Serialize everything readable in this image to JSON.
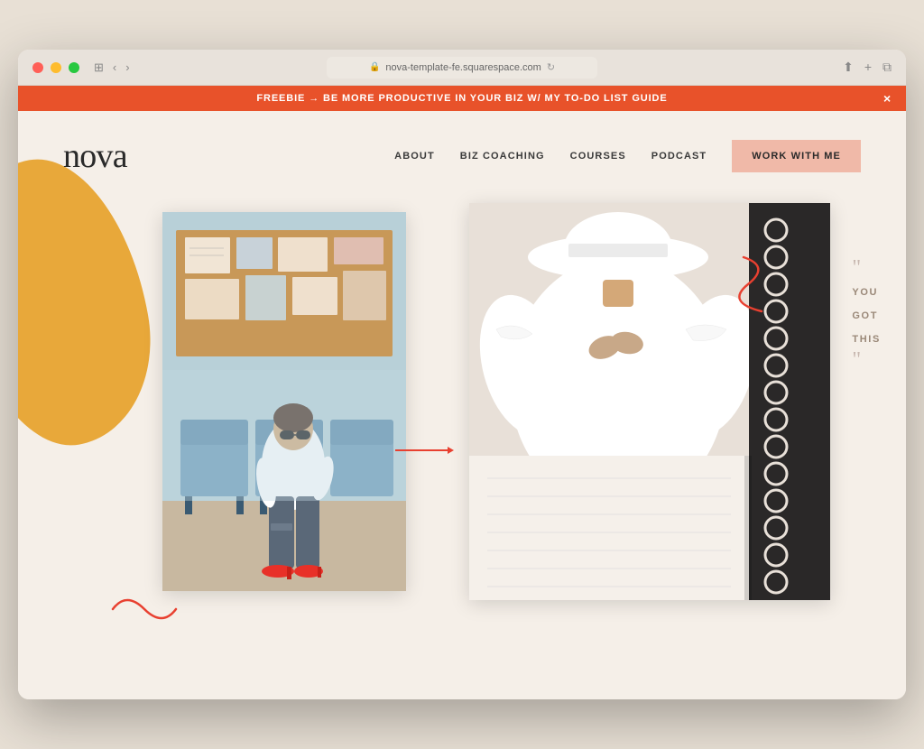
{
  "window": {
    "url": "nova-template-fe.squarespace.com",
    "title": "nova"
  },
  "banner": {
    "text": "FREEBIE → BE MORE PRODUCTIVE IN YOUR BIZ W/ MY TO-DO LIST GUIDE",
    "close": "×"
  },
  "nav": {
    "logo": "nova",
    "links": [
      {
        "label": "ABOUT",
        "id": "about"
      },
      {
        "label": "BIZ COACHING",
        "id": "biz-coaching"
      },
      {
        "label": "COURSES",
        "id": "courses"
      },
      {
        "label": "PODCAST",
        "id": "podcast"
      }
    ],
    "cta": "WORK WITH ME"
  },
  "quote": {
    "open_mark": "\"",
    "line1": "YOU",
    "line2": "GOT",
    "line3": "THIS",
    "close_mark": "\""
  },
  "images": {
    "left": "Woman in white shirt and jeans sitting on blue chairs in a waiting room with a bulletin board",
    "right": "Woman in white dress holding phone, overlaid with spiral notebook"
  }
}
